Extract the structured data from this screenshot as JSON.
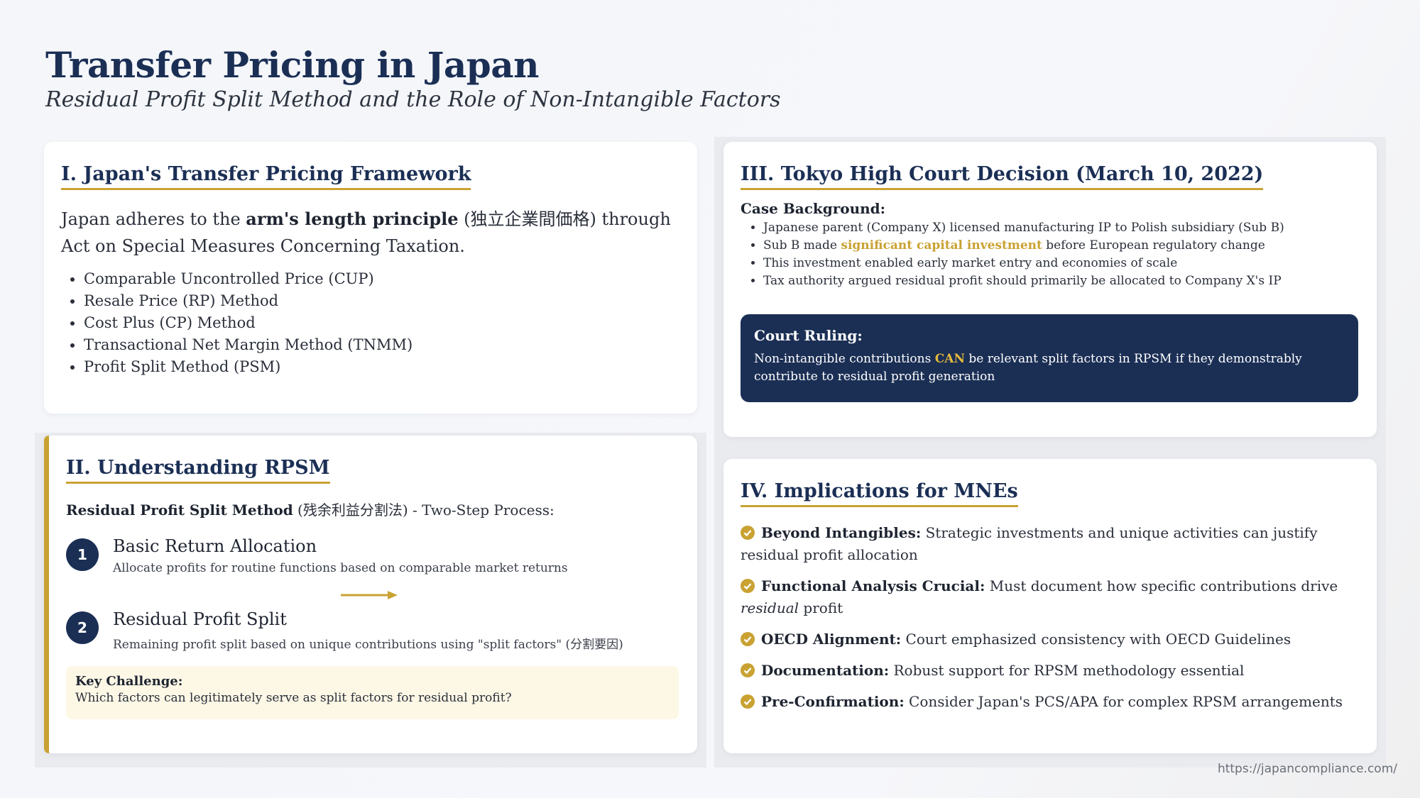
{
  "header": {
    "title": "Transfer Pricing in Japan",
    "subtitle": "Residual Profit Split Method and the Role of Non-Intangible Factors"
  },
  "section1": {
    "title": "I. Japan's Transfer Pricing Framework",
    "intro_before": "Japan adheres to the ",
    "intro_bold": "arm's length principle",
    "intro_after": " (独立企業間価格) through Act on Special Measures Concerning Taxation.",
    "methods": [
      "Comparable Uncontrolled Price (CUP)",
      "Resale Price (RP) Method",
      "Cost Plus (CP) Method",
      "Transactional Net Margin Method (TNMM)",
      "Profit Split Method (PSM)"
    ]
  },
  "section2": {
    "title": "II. Understanding RPSM",
    "subtitle_bold": "Residual Profit Split Method",
    "subtitle_rest": " (残余利益分割法) - Two-Step Process:",
    "steps": [
      {
        "number": "1",
        "title": "Basic Return Allocation",
        "description": "Allocate profits for routine functions based on comparable market returns"
      },
      {
        "number": "2",
        "title": "Residual Profit Split",
        "description": "Remaining profit split based on unique contributions using \"split factors\" (分割要因)"
      }
    ],
    "challenge_title": "Key Challenge:",
    "challenge_text": "Which factors can legitimately serve as split factors for residual profit?"
  },
  "section3": {
    "title": "III. Tokyo High Court Decision (March 10, 2022)",
    "background_title": "Case Background:",
    "background": [
      {
        "text": "Japanese parent (Company X) licensed manufacturing IP to Polish subsidiary (Sub B)"
      },
      {
        "before": "Sub B made ",
        "highlight": "significant capital investment",
        "after": " before European regulatory change"
      },
      {
        "text": "This investment enabled early market entry and economies of scale"
      },
      {
        "text": "Tax authority argued residual profit should primarily be allocated to Company X's IP"
      }
    ],
    "ruling_title": "Court Ruling:",
    "ruling_before": "Non-intangible contributions ",
    "ruling_highlight": "CAN",
    "ruling_after": " be relevant split factors in RPSM if they demonstrably contribute to residual profit generation"
  },
  "section4": {
    "title": "IV. Implications for MNEs",
    "items": [
      {
        "bold": "Beyond Intangibles:",
        "text": " Strategic investments and unique activities can justify residual profit allocation"
      },
      {
        "bold": "Functional Analysis Crucial:",
        "text": " Must document how specific contributions drive ",
        "italic": "residual",
        "text2": " profit"
      },
      {
        "bold": "OECD Alignment:",
        "text": " Court emphasized consistency with OECD Guidelines"
      },
      {
        "bold": "Documentation:",
        "text": " Robust support for RPSM methodology essential"
      },
      {
        "bold": "Pre-Confirmation:",
        "text": " Consider Japan's PCS/APA for complex RPSM arrangements"
      }
    ]
  },
  "footer": {
    "url": "https://japancompliance.com/"
  },
  "colors": {
    "navy": "#1b2f55",
    "gold": "#c9a233",
    "challenge_bg": "#fdf8e6"
  },
  "icons": {
    "check": "check-circle-icon",
    "arrow": "arrow-right-icon"
  }
}
